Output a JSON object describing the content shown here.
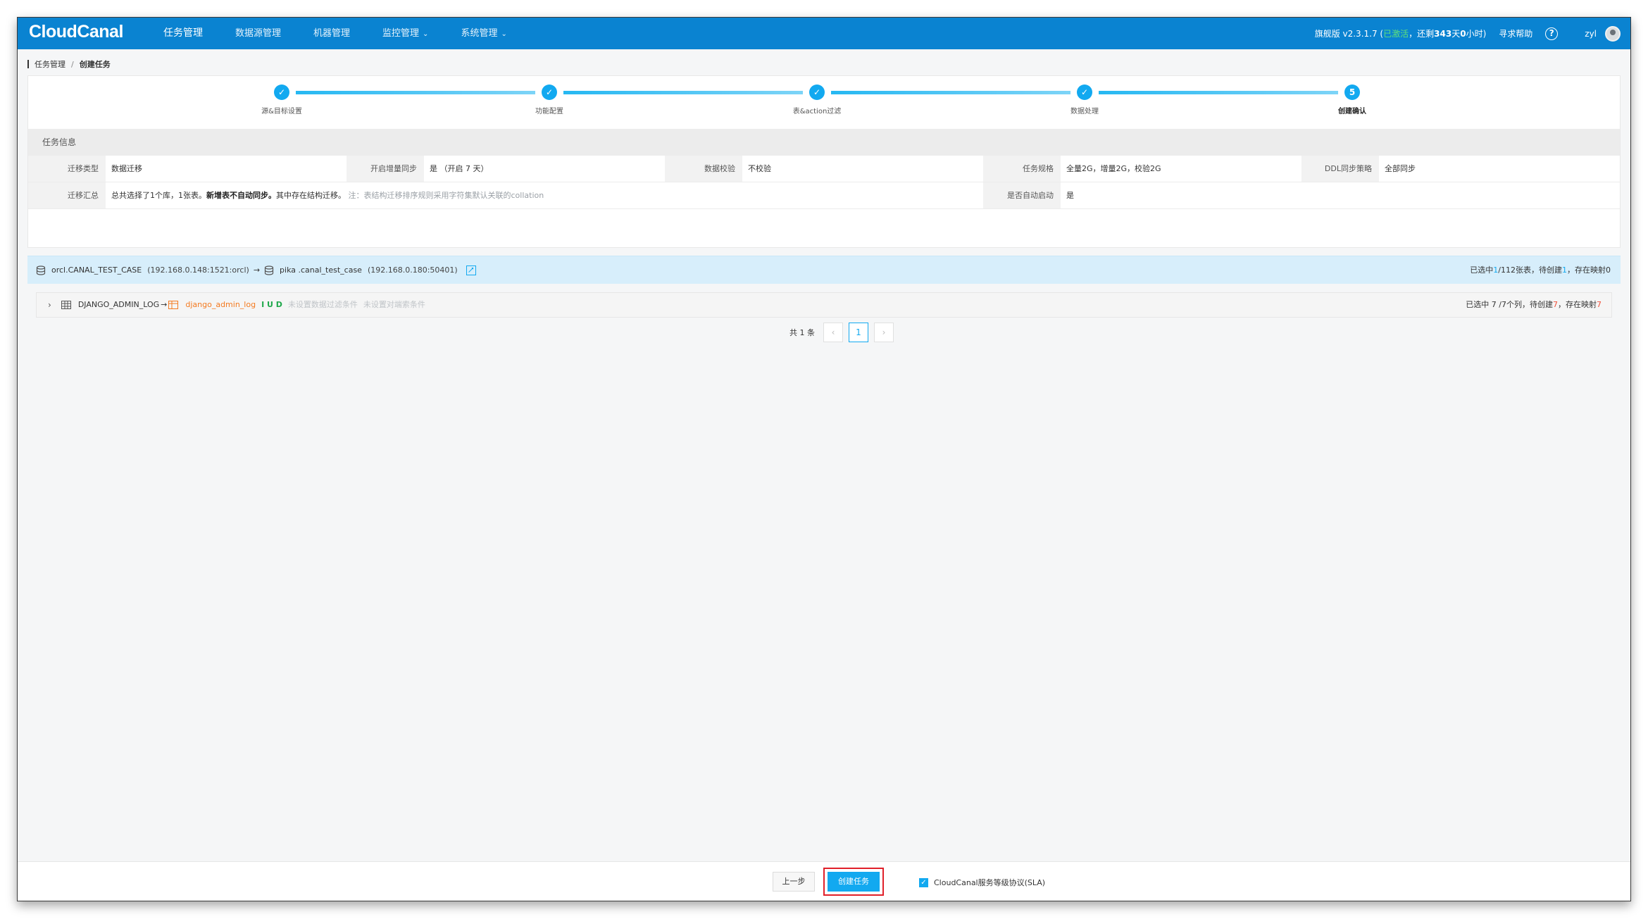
{
  "nav": {
    "logo": "CloudCanal",
    "menu": [
      {
        "label": "任务管理",
        "active": true,
        "dropdown": false
      },
      {
        "label": "数据源管理",
        "active": false,
        "dropdown": false
      },
      {
        "label": "机器管理",
        "active": false,
        "dropdown": false
      },
      {
        "label": "监控管理",
        "active": false,
        "dropdown": true
      },
      {
        "label": "系统管理",
        "active": false,
        "dropdown": true
      }
    ],
    "version_prefix": "旗舰版 v2.3.1.7 (",
    "activated": "已激活",
    "remaining_prefix": "，还剩",
    "remaining_days": "343",
    "days_unit": "天",
    "remaining_hours": "0",
    "hours_unit": "小时)",
    "help_label": "寻求帮助",
    "help_icon": "?",
    "user": "zyl"
  },
  "breadcrumb": {
    "parent": "任务管理",
    "separator": "/",
    "current": "创建任务"
  },
  "steps": [
    {
      "label": "源&目标设置",
      "status": "done",
      "mark": "✓"
    },
    {
      "label": "功能配置",
      "status": "done",
      "mark": "✓"
    },
    {
      "label": "表&action过滤",
      "status": "done",
      "mark": "✓"
    },
    {
      "label": "数据处理",
      "status": "done",
      "mark": "✓"
    },
    {
      "label": "创建确认",
      "status": "current",
      "mark": "5"
    }
  ],
  "task_info": {
    "title": "任务信息",
    "row1": [
      {
        "label": "迁移类型",
        "value": "数据迁移"
      },
      {
        "label": "开启增量同步",
        "value": "是 （开启 7 天）"
      },
      {
        "label": "数据校验",
        "value": "不校验"
      },
      {
        "label": "任务规格",
        "value": "全量2G，增量2G，校验2G"
      },
      {
        "label": "DDL同步策略",
        "value": "全部同步"
      }
    ],
    "summary_label": "迁移汇总",
    "summary_prefix": "总共选择了1个库，1张表。",
    "summary_bold": "新增表不自动同步。",
    "summary_mid": "其中存在结构迁移。",
    "summary_note": "注：表结构迁移排序规则采用字符集默认关联的collation",
    "autostart_label": "是否自动启动",
    "autostart_value": "是"
  },
  "db_mapping": {
    "source": "orcl.CANAL_TEST_CASE",
    "source_addr": "(192.168.0.148:1521:orcl)",
    "arrow": "→",
    "target": "pika .canal_test_case",
    "target_addr": "(192.168.0.180:50401)",
    "status_prefix": "已选中",
    "selected": "1",
    "status_sep": "/112张表，待创建",
    "to_create": "1",
    "status_suffix": "，存在映射0"
  },
  "table_row": {
    "chevron": "›",
    "source_table": "DJANGO_ADMIN_LOG",
    "arrow": "→",
    "target_table": "django_admin_log",
    "actions": "I U D",
    "filter_hint": "未设置数据过滤条件",
    "redis_hint": "未设置对端索条件",
    "status_prefix": "已选中 7 /7个列，待创建",
    "to_create": "7",
    "status_mid": "，存在映射",
    "mapped": "7"
  },
  "pager": {
    "total": "共 1 条",
    "prev": "‹",
    "page": "1",
    "next": "›"
  },
  "footer": {
    "prev_label": "上一步",
    "create_label": "创建任务",
    "sla_label": "CloudCanal服务等级协议(SLA)",
    "sla_checked": true
  },
  "colors": {
    "nav_bg": "#0a83d1",
    "accent": "#12a9f0",
    "highlight_border": "#e0202a"
  }
}
